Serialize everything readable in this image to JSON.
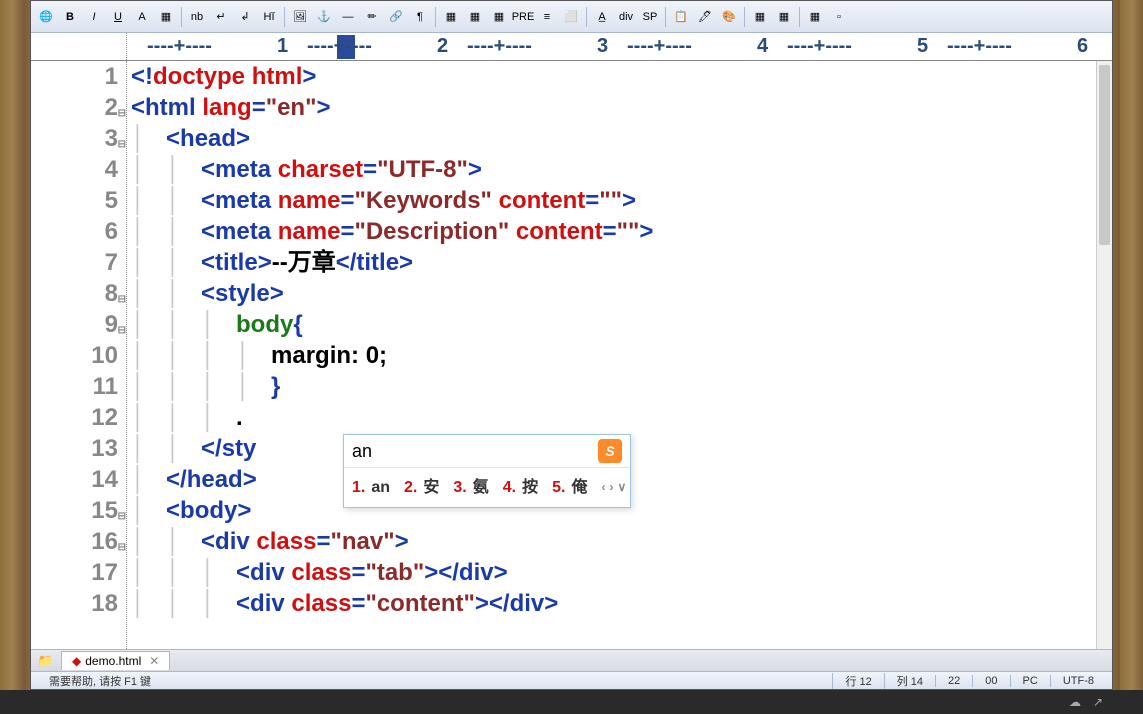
{
  "toolbar": {
    "buttons": [
      "🌐",
      "B",
      "I",
      "U",
      "A",
      "▦",
      "",
      "nb",
      "↵",
      "↲",
      "Hĭ",
      "",
      "🖼",
      "⚓",
      "—",
      "✏",
      "🔗",
      "¶",
      "",
      "▦",
      "▦",
      "▦",
      "PRE",
      "≡",
      "⬜",
      "",
      "A̲",
      "div",
      "SP",
      "",
      "📋",
      "🖊",
      "🎨",
      "",
      "▦",
      "▦",
      "",
      "▦",
      "▫"
    ]
  },
  "ruler": {
    "marks": [
      "1",
      "2",
      "3",
      "4",
      "5",
      "6"
    ]
  },
  "gutter": {
    "lines": [
      {
        "n": "1"
      },
      {
        "n": "2",
        "fold": "⊟"
      },
      {
        "n": "3",
        "fold": "⊟"
      },
      {
        "n": "4"
      },
      {
        "n": "5"
      },
      {
        "n": "6"
      },
      {
        "n": "7"
      },
      {
        "n": "8",
        "fold": "⊟"
      },
      {
        "n": "9",
        "fold": "⊟"
      },
      {
        "n": "10"
      },
      {
        "n": "11"
      },
      {
        "n": "12",
        "arrow": "▸"
      },
      {
        "n": "13"
      },
      {
        "n": "14"
      },
      {
        "n": "15",
        "fold": "⊟"
      },
      {
        "n": "16",
        "fold": "⊟"
      },
      {
        "n": "17"
      },
      {
        "n": "18"
      }
    ]
  },
  "code": [
    [
      {
        "c": "t-blue",
        "t": "<!"
      },
      {
        "c": "t-red",
        "t": "doctype html"
      },
      {
        "c": "t-blue",
        "t": ">"
      }
    ],
    [
      {
        "c": "t-blue",
        "t": "<html "
      },
      {
        "c": "t-red",
        "t": "lang"
      },
      {
        "c": "t-blue",
        "t": "="
      },
      {
        "c": "t-brown",
        "t": "\"en\""
      },
      {
        "c": "t-blue",
        "t": ">"
      }
    ],
    [
      {
        "c": "guide",
        "t": "    "
      },
      {
        "c": "t-blue",
        "t": "<head>"
      }
    ],
    [
      {
        "c": "guide",
        "t": "        "
      },
      {
        "c": "t-blue",
        "t": "<meta "
      },
      {
        "c": "t-red",
        "t": "charset"
      },
      {
        "c": "t-blue",
        "t": "="
      },
      {
        "c": "t-brown",
        "t": "\"UTF-8\""
      },
      {
        "c": "t-blue",
        "t": ">"
      }
    ],
    [
      {
        "c": "guide",
        "t": "        "
      },
      {
        "c": "t-blue",
        "t": "<meta "
      },
      {
        "c": "t-red",
        "t": "name"
      },
      {
        "c": "t-blue",
        "t": "="
      },
      {
        "c": "t-brown",
        "t": "\"Keywords\""
      },
      {
        "c": "t-blue",
        "t": " "
      },
      {
        "c": "t-red",
        "t": "content"
      },
      {
        "c": "t-blue",
        "t": "="
      },
      {
        "c": "t-brown",
        "t": "\"\""
      },
      {
        "c": "t-blue",
        "t": ">"
      }
    ],
    [
      {
        "c": "guide",
        "t": "        "
      },
      {
        "c": "t-blue",
        "t": "<meta "
      },
      {
        "c": "t-red",
        "t": "name"
      },
      {
        "c": "t-blue",
        "t": "="
      },
      {
        "c": "t-brown",
        "t": "\"Description\""
      },
      {
        "c": "t-blue",
        "t": " "
      },
      {
        "c": "t-red",
        "t": "content"
      },
      {
        "c": "t-blue",
        "t": "="
      },
      {
        "c": "t-brown",
        "t": "\"\""
      },
      {
        "c": "t-blue",
        "t": ">"
      }
    ],
    [
      {
        "c": "guide",
        "t": "        "
      },
      {
        "c": "t-blue",
        "t": "<title>"
      },
      {
        "c": "t-black",
        "t": "--万章"
      },
      {
        "c": "t-blue",
        "t": "</title>"
      }
    ],
    [
      {
        "c": "guide",
        "t": "        "
      },
      {
        "c": "t-blue",
        "t": "<style>"
      }
    ],
    [
      {
        "c": "guide",
        "t": "            "
      },
      {
        "c": "t-green",
        "t": "body"
      },
      {
        "c": "t-blue",
        "t": "{"
      }
    ],
    [
      {
        "c": "guide",
        "t": "                "
      },
      {
        "c": "t-black",
        "t": "margin: 0;"
      }
    ],
    [
      {
        "c": "guide",
        "t": "                "
      },
      {
        "c": "t-blue",
        "t": "}"
      }
    ],
    [
      {
        "c": "guide",
        "t": "            "
      },
      {
        "c": "t-black",
        "t": "."
      }
    ],
    [
      {
        "c": "guide",
        "t": "        "
      },
      {
        "c": "t-blue",
        "t": "</sty"
      }
    ],
    [
      {
        "c": "guide",
        "t": "    "
      },
      {
        "c": "t-blue",
        "t": "</head>"
      }
    ],
    [
      {
        "c": "guide",
        "t": "    "
      },
      {
        "c": "t-blue",
        "t": "<body>"
      }
    ],
    [
      {
        "c": "guide",
        "t": "        "
      },
      {
        "c": "t-blue",
        "t": "<div "
      },
      {
        "c": "t-red",
        "t": "class"
      },
      {
        "c": "t-blue",
        "t": "="
      },
      {
        "c": "t-brown",
        "t": "\"nav\""
      },
      {
        "c": "t-blue",
        "t": ">"
      }
    ],
    [
      {
        "c": "guide",
        "t": "            "
      },
      {
        "c": "t-blue",
        "t": "<div "
      },
      {
        "c": "t-red",
        "t": "class"
      },
      {
        "c": "t-blue",
        "t": "="
      },
      {
        "c": "t-brown",
        "t": "\"tab\""
      },
      {
        "c": "t-blue",
        "t": "></div>"
      }
    ],
    [
      {
        "c": "guide",
        "t": "            "
      },
      {
        "c": "t-blue",
        "t": "<div "
      },
      {
        "c": "t-red",
        "t": "class"
      },
      {
        "c": "t-blue",
        "t": "="
      },
      {
        "c": "t-brown",
        "t": "\"content\""
      },
      {
        "c": "t-blue",
        "t": "></div>"
      }
    ]
  ],
  "ime": {
    "input": "an",
    "candidates": [
      {
        "n": "1.",
        "w": "an"
      },
      {
        "n": "2.",
        "w": "安"
      },
      {
        "n": "3.",
        "w": "氨"
      },
      {
        "n": "4.",
        "w": "按"
      },
      {
        "n": "5.",
        "w": "俺"
      }
    ]
  },
  "tab": {
    "name": "demo.html"
  },
  "status": {
    "help": "需要帮助, 请按 F1 键",
    "line": "行 12",
    "col": "列 14",
    "sel": "22",
    "ins": "00",
    "mode": "PC",
    "enc": "UTF-8"
  }
}
